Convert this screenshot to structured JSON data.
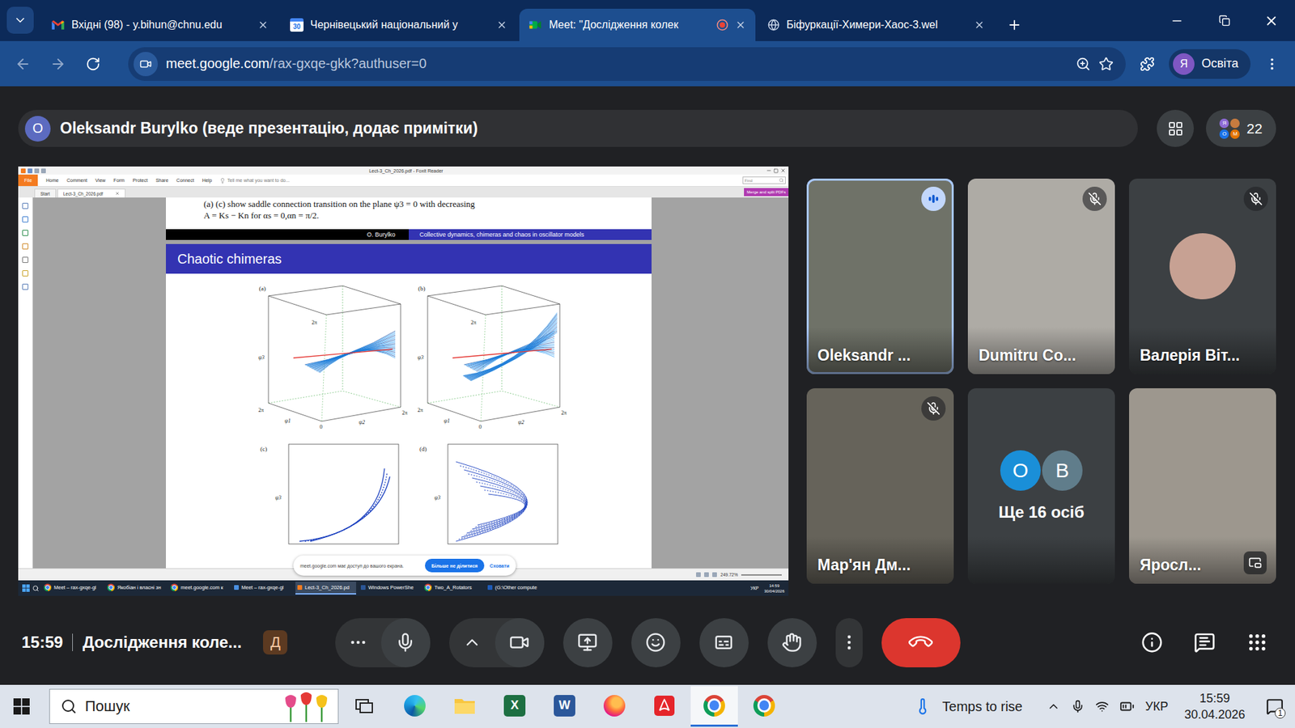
{
  "browser": {
    "tabs": [
      {
        "label": "Вхідні (98) - y.bihun@chnu.edu",
        "kind": "gmail",
        "badge": "",
        "selected": false,
        "recording": false
      },
      {
        "label": "Чернівецький національний у",
        "kind": "calendar",
        "badge": "30",
        "selected": false,
        "recording": false
      },
      {
        "label": "Meet: \"Дослідження колек",
        "kind": "meet",
        "badge": "",
        "selected": true,
        "recording": true
      },
      {
        "label": "Біфуркації-Химери-Хаос-3.wel",
        "kind": "globe",
        "badge": "",
        "selected": false,
        "recording": false
      }
    ],
    "address": {
      "host": "meet.google.com",
      "path": "/rax-gxqe-gkk?authuser=0"
    },
    "profile": {
      "initial": "Я",
      "label": "Освіта"
    }
  },
  "meet": {
    "presenter": {
      "initial": "O",
      "text": "Oleksandr Burylko (веде презентацію, додає примітки)"
    },
    "participants": {
      "count": "22",
      "avatars": [
        {
          "initial": "Я",
          "color": "#8e6bd6"
        },
        {
          "initial": "",
          "color": "#c77b3f"
        },
        {
          "initial": "O",
          "color": "#1a73e8"
        },
        {
          "initial": "M",
          "color": "#e37400"
        }
      ]
    },
    "share": {
      "window_title": "Lect-3_Ch_2026.pdf - Foxit Reader",
      "menu": [
        {
          "label": "File",
          "selected": true
        },
        {
          "label": "Home",
          "selected": false
        },
        {
          "label": "Comment",
          "selected": false
        },
        {
          "label": "View",
          "selected": false
        },
        {
          "label": "Form",
          "selected": false
        },
        {
          "label": "Protect",
          "selected": false
        },
        {
          "label": "Share",
          "selected": false
        },
        {
          "label": "Connect",
          "selected": false
        },
        {
          "label": "Help",
          "selected": false
        }
      ],
      "tell_me": "Tell me what you want to do...",
      "find": "Find",
      "doc_tabs": [
        {
          "label": "Start",
          "selected": false
        },
        {
          "label": "Lect-3_Ch_2026.pdf",
          "selected": true
        }
      ],
      "merge_button": "Merge and split PDFs",
      "page": {
        "caption_lines": [
          "(a) (c) show saddle connection transition on the plane ψ3 = 0 with decreasing",
          "A = Ks − Kn for αs = 0,αn = π/2."
        ],
        "footer_author": "O. Burylko",
        "footer_title": "Collective dynamics, chimeras and chaos in oscillator models",
        "slide_title": "Chaotic chimeras",
        "plots": [
          {
            "label": "(a)",
            "kind": "3d",
            "curves": 20,
            "branches": 1,
            "axis_labels": [
              "2π",
              "ψ3",
              "2π",
              "ψ1",
              "0",
              "ψ2",
              "2π"
            ]
          },
          {
            "label": "(b)",
            "kind": "3d",
            "curves": 30,
            "branches": 2,
            "axis_labels": [
              "2π",
              "ψ3",
              "2π",
              "ψ1",
              "0",
              "ψ2",
              "2π"
            ]
          },
          {
            "label": "(c)",
            "kind": "2d",
            "curves": 3,
            "branches": 1,
            "axis_labels": [
              "ψ3"
            ]
          },
          {
            "label": "(d)",
            "kind": "2d",
            "curves": 9,
            "branches": 1,
            "axis_labels": [
              "ψ3"
            ]
          }
        ]
      },
      "zoom": "249.72%",
      "notice": {
        "text": "meet.google.com має доступ до вашого екрана.",
        "stop": "Більше не ділитися",
        "hide": "Сховати"
      },
      "taskbar": {
        "items": [
          {
            "label": "Meet – rax-gxqe-gl",
            "kind": "chrome",
            "active": false
          },
          {
            "label": "Якобіан і власні зн",
            "kind": "chrome",
            "active": false
          },
          {
            "label": "meet.google.com к",
            "kind": "chrome",
            "active": false
          },
          {
            "label": "Meet – rax-gxqe-gl",
            "kind": "browser",
            "active": false
          },
          {
            "label": "Lect-3_Ch_2026.pd",
            "kind": "foxit",
            "active": true
          },
          {
            "label": "Windows PowerShe",
            "kind": "powershell",
            "active": false
          },
          {
            "label": "Two_A_Rotators",
            "kind": "chrome",
            "active": false
          },
          {
            "label": "(G:\\Other compute",
            "kind": "matlab",
            "active": false
          }
        ],
        "language": "УКР",
        "time": "14:59",
        "date": "30/04/2026"
      }
    },
    "tiles": [
      {
        "name": "Oleksandr ...",
        "kind": "video",
        "color": "#6f7268",
        "muted": false,
        "speaking": true,
        "pip": false,
        "initials": []
      },
      {
        "name": "Dumitru Co...",
        "kind": "video",
        "color": "#aeaba5",
        "muted": true,
        "speaking": false,
        "pip": false,
        "initials": []
      },
      {
        "name": "Валерія Віт...",
        "kind": "avatar",
        "color": "#c7a193",
        "muted": true,
        "speaking": false,
        "pip": false,
        "initials": []
      },
      {
        "name": "Мар'ян Дм...",
        "kind": "video",
        "color": "#66635a",
        "muted": true,
        "speaking": false,
        "pip": false,
        "initials": []
      },
      {
        "name": "Ще 16 осіб",
        "kind": "more",
        "color": "#3c4043",
        "muted": false,
        "speaking": false,
        "pip": false,
        "initials": [
          {
            "initial": "O",
            "color": "#1a8fd8"
          },
          {
            "initial": "В",
            "color": "#607d8b"
          }
        ]
      },
      {
        "name": "Яросл...",
        "kind": "video",
        "color": "#9d978e",
        "muted": false,
        "speaking": false,
        "pip": true,
        "initials": []
      }
    ],
    "bottom_bar": {
      "time": "15:59",
      "title": "Дослідження коле...",
      "badge": "Д",
      "mic_on": true,
      "camera_on": true,
      "hand_raised": false,
      "captions_on": false
    }
  },
  "taskbar": {
    "search": "Пошук",
    "apps": [
      {
        "kind": "taskview",
        "letter": "",
        "active": false
      },
      {
        "kind": "edge",
        "letter": "",
        "active": false
      },
      {
        "kind": "explorer",
        "letter": "",
        "active": false
      },
      {
        "kind": "excel",
        "letter": "X",
        "active": false
      },
      {
        "kind": "word",
        "letter": "W",
        "active": false
      },
      {
        "kind": "firefox",
        "letter": "",
        "active": false
      },
      {
        "kind": "acrobat",
        "letter": "",
        "active": false
      },
      {
        "kind": "chrome",
        "letter": "",
        "active": true
      },
      {
        "kind": "chrome",
        "letter": "",
        "active": false
      }
    ],
    "weather": "Temps to rise",
    "language": "УКР",
    "time": "15:59",
    "date": "30.04.2026",
    "notifications": "1"
  }
}
